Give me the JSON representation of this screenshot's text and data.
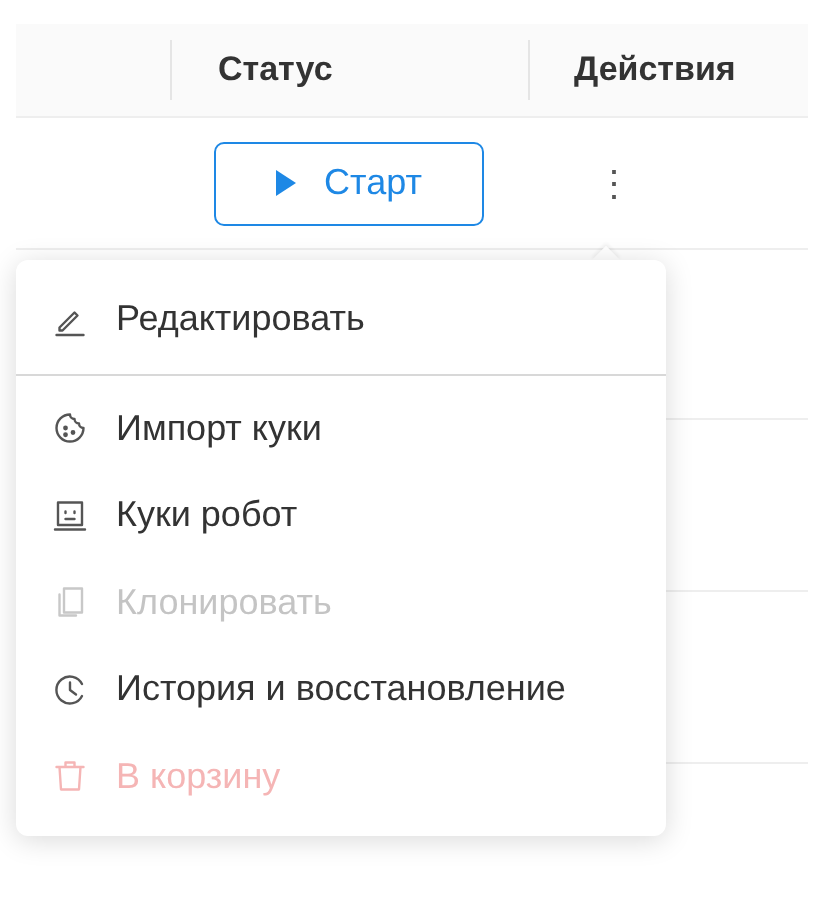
{
  "table": {
    "columns": [
      {
        "label": "Статус"
      },
      {
        "label": "Действия"
      }
    ],
    "row": {
      "start_button": "Старт",
      "more_icon": "⋮"
    }
  },
  "menu": {
    "items": [
      {
        "label": "Редактировать",
        "kind": "edit",
        "disabled": false,
        "danger": false,
        "divider_after": true
      },
      {
        "label": "Импорт куки",
        "kind": "cookie",
        "disabled": false,
        "danger": false,
        "divider_after": false
      },
      {
        "label": "Куки робот",
        "kind": "robot",
        "disabled": false,
        "danger": false,
        "divider_after": false
      },
      {
        "label": "Клонировать",
        "kind": "copy",
        "disabled": true,
        "danger": false,
        "divider_after": false
      },
      {
        "label": "История и восстановление",
        "kind": "history",
        "disabled": false,
        "danger": false,
        "divider_after": false
      },
      {
        "label": "В корзину",
        "kind": "trash",
        "disabled": true,
        "danger": true,
        "divider_after": false
      }
    ]
  }
}
